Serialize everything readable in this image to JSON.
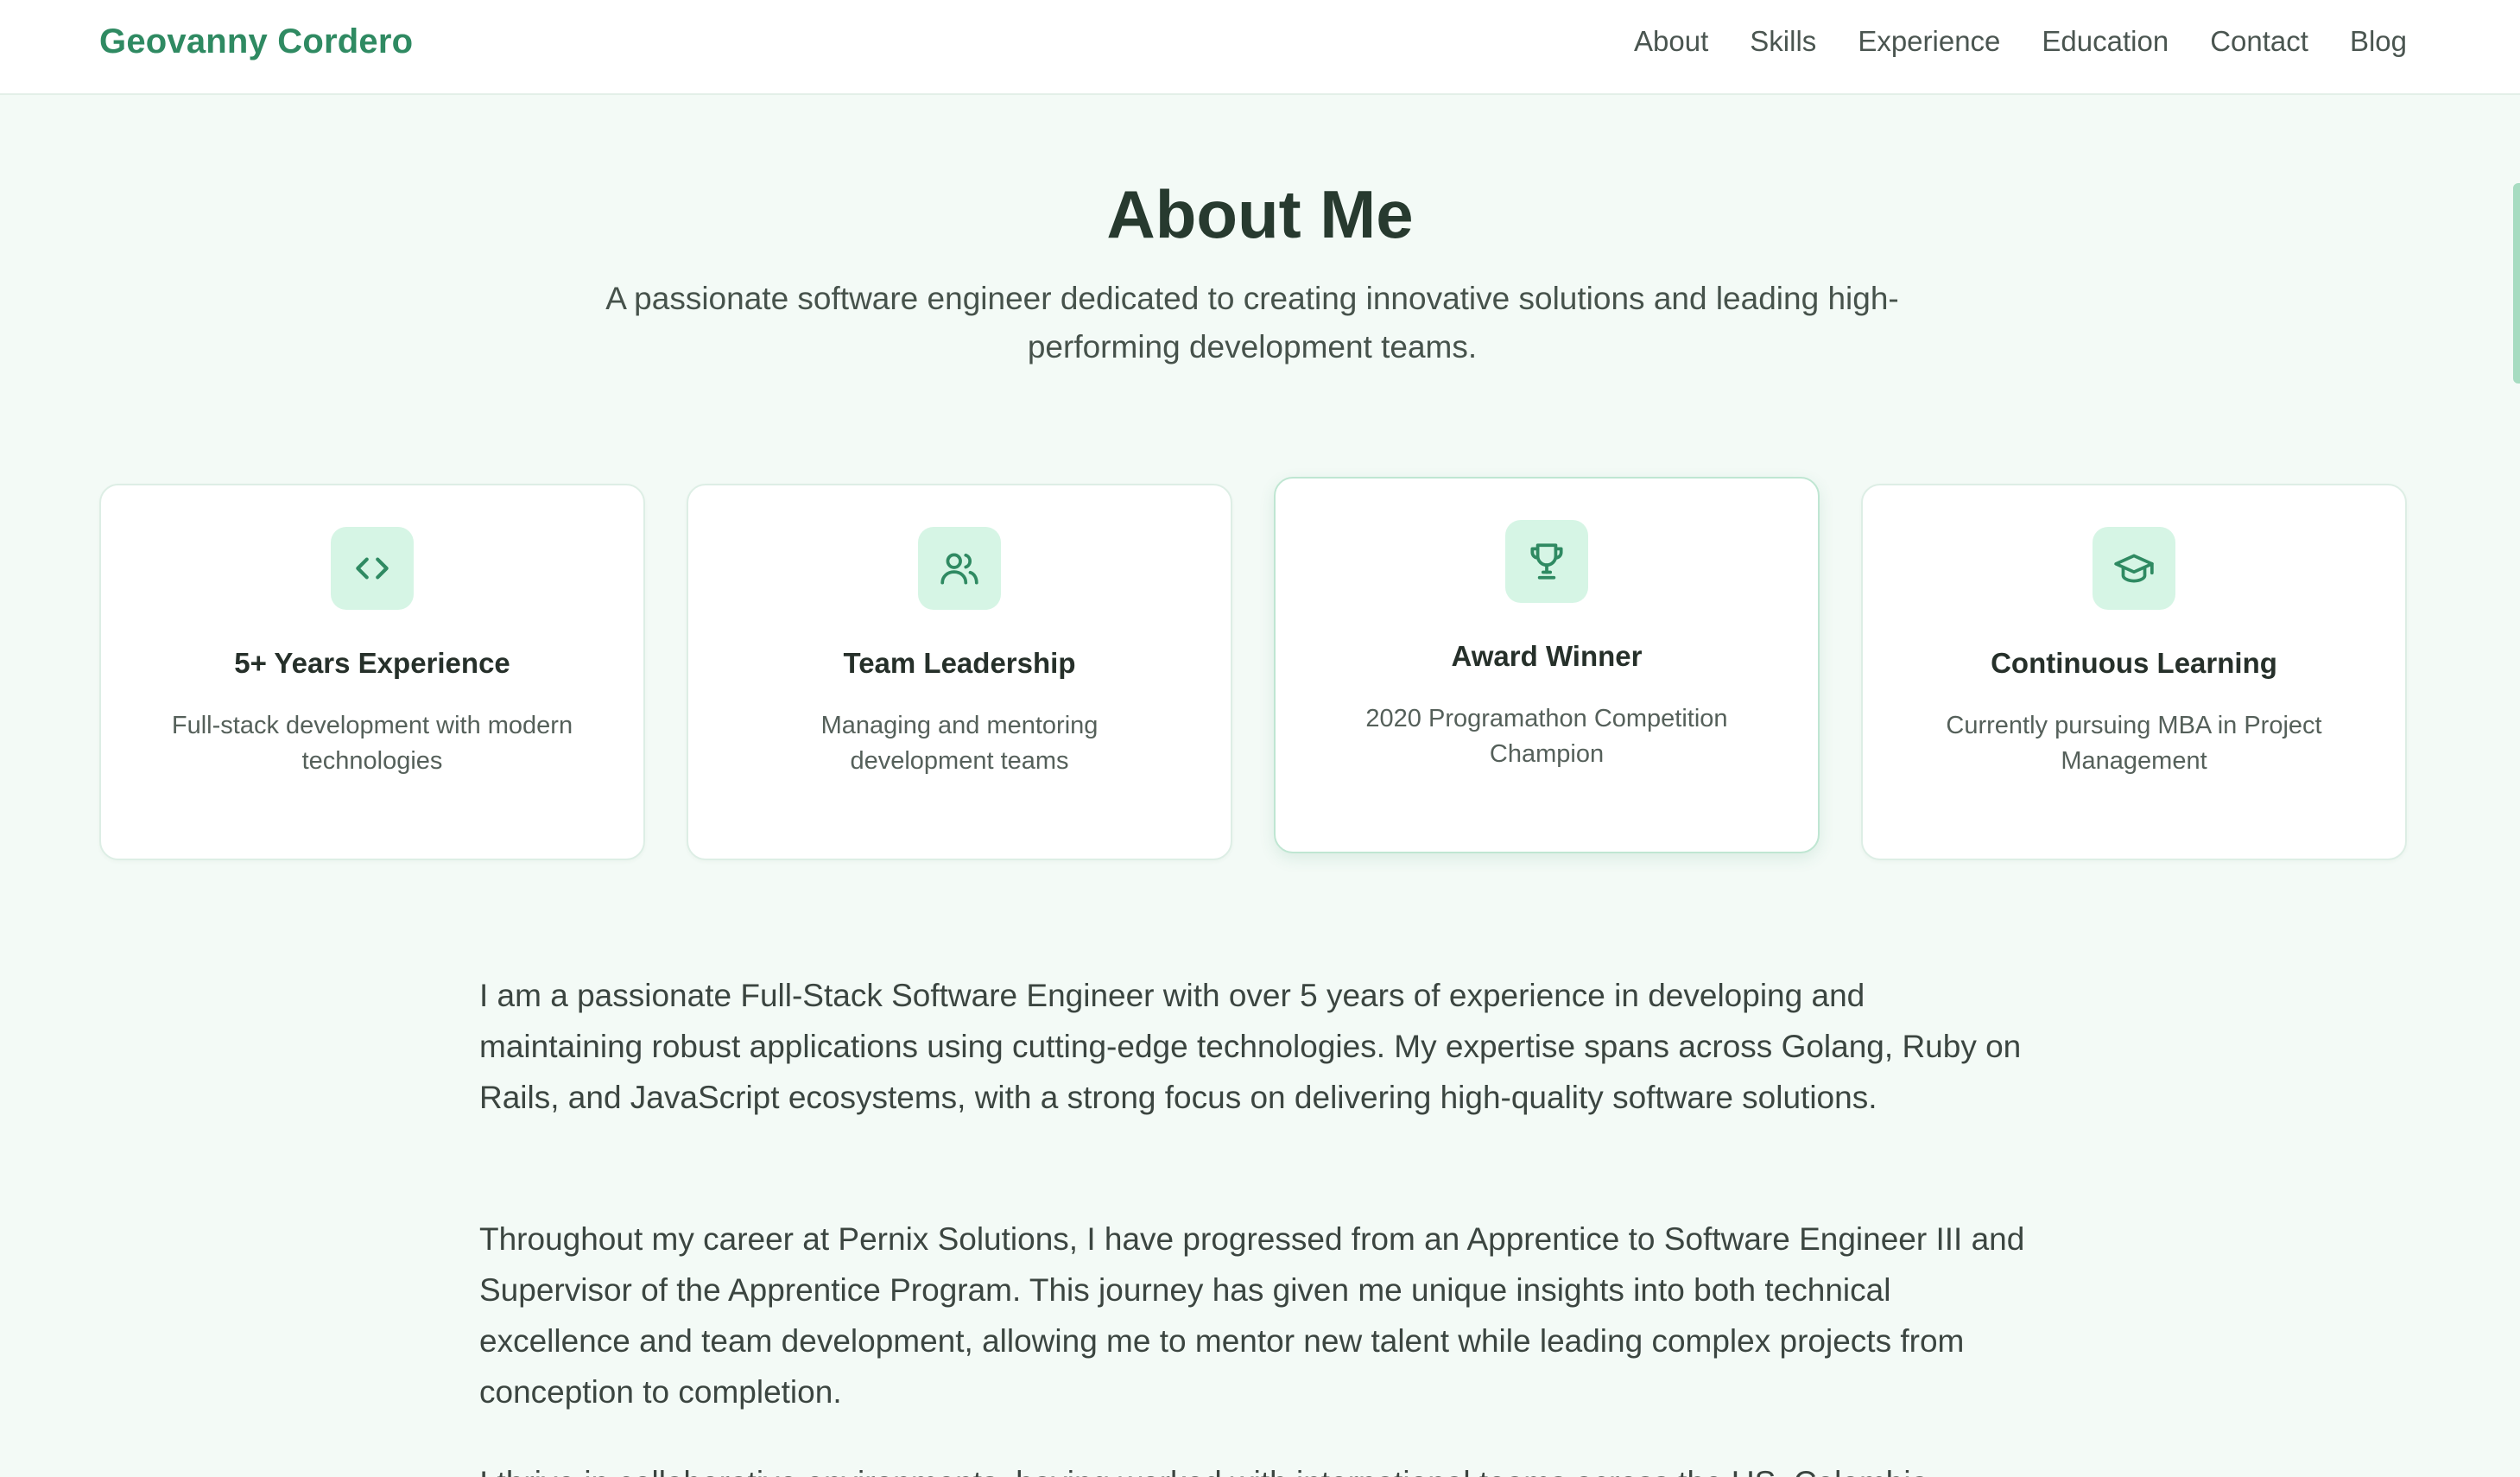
{
  "header": {
    "brand": "Geovanny Cordero",
    "nav": [
      "About",
      "Skills",
      "Experience",
      "Education",
      "Contact",
      "Blog"
    ]
  },
  "about": {
    "title": "About Me",
    "subtitle": "A passionate software engineer dedicated to creating innovative solutions and leading high-performing development teams.",
    "cards": [
      {
        "icon": "code-icon",
        "title": "5+ Years Experience",
        "description": "Full-stack development with modern technologies"
      },
      {
        "icon": "users-icon",
        "title": "Team Leadership",
        "description": "Managing and mentoring development teams"
      },
      {
        "icon": "trophy-icon",
        "title": "Award Winner",
        "description": "2020 Programathon Competition Champion"
      },
      {
        "icon": "graduation-cap-icon",
        "title": "Continuous Learning",
        "description": "Currently pursuing MBA in Project Management"
      }
    ],
    "paragraphs": [
      "I am a passionate Full-Stack Software Engineer with over 5 years of experience in developing and maintaining robust applications using cutting-edge technologies. My expertise spans across Golang, Ruby on Rails, and JavaScript ecosystems, with a strong focus on delivering high-quality software solutions.",
      "Throughout my career at Pernix Solutions, I have progressed from an Apprentice to Software Engineer III and Supervisor of the Apprentice Program. This journey has given me unique insights into both technical excellence and team development, allowing me to mentor new talent while leading complex projects from conception to completion.",
      "I thrive in collaborative environments, having worked with international teams across the US, Colombia"
    ]
  },
  "colors": {
    "accent": "#2f8a62",
    "icon_bg": "#d6f5e5",
    "page_bg": "#f3faf6"
  }
}
